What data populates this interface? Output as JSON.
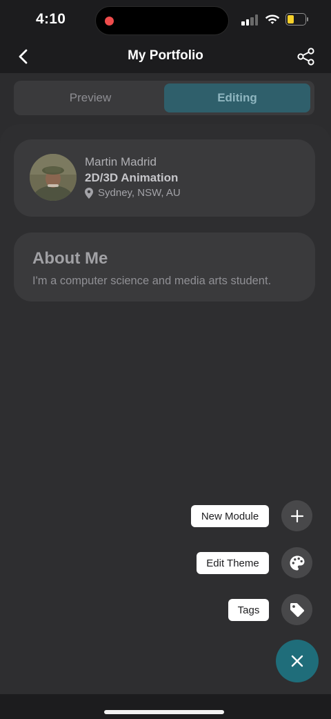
{
  "status_bar": {
    "time": "4:10",
    "icons": [
      "recording-dot-icon",
      "cellular-signal-icon",
      "wifi-icon",
      "battery-icon"
    ],
    "battery_level": 0.3,
    "signal_bars": 2,
    "recording_color": "#ef4c4c",
    "battery_color": "#f6d02a"
  },
  "nav": {
    "title": "My Portfolio",
    "back_icon": "chevron-left-icon",
    "share_icon": "share-icon"
  },
  "segmented": {
    "options": [
      "Preview",
      "Editing"
    ],
    "selected": "Editing",
    "accent": "#2f5f6b"
  },
  "profile": {
    "name": "Martin Madrid",
    "title": "2D/3D Animation",
    "location": "Sydney, NSW, AU",
    "location_icon": "map-pin-icon"
  },
  "about": {
    "heading": "About Me",
    "body": "I'm a computer science and media arts student."
  },
  "fab_menu": {
    "items": [
      {
        "label": "New Module",
        "icon": "plus-icon"
      },
      {
        "label": "Edit Theme",
        "icon": "palette-icon"
      },
      {
        "label": "Tags",
        "icon": "tag-icon"
      }
    ],
    "close_icon": "close-icon",
    "fab_color": "#1f6d7a"
  }
}
